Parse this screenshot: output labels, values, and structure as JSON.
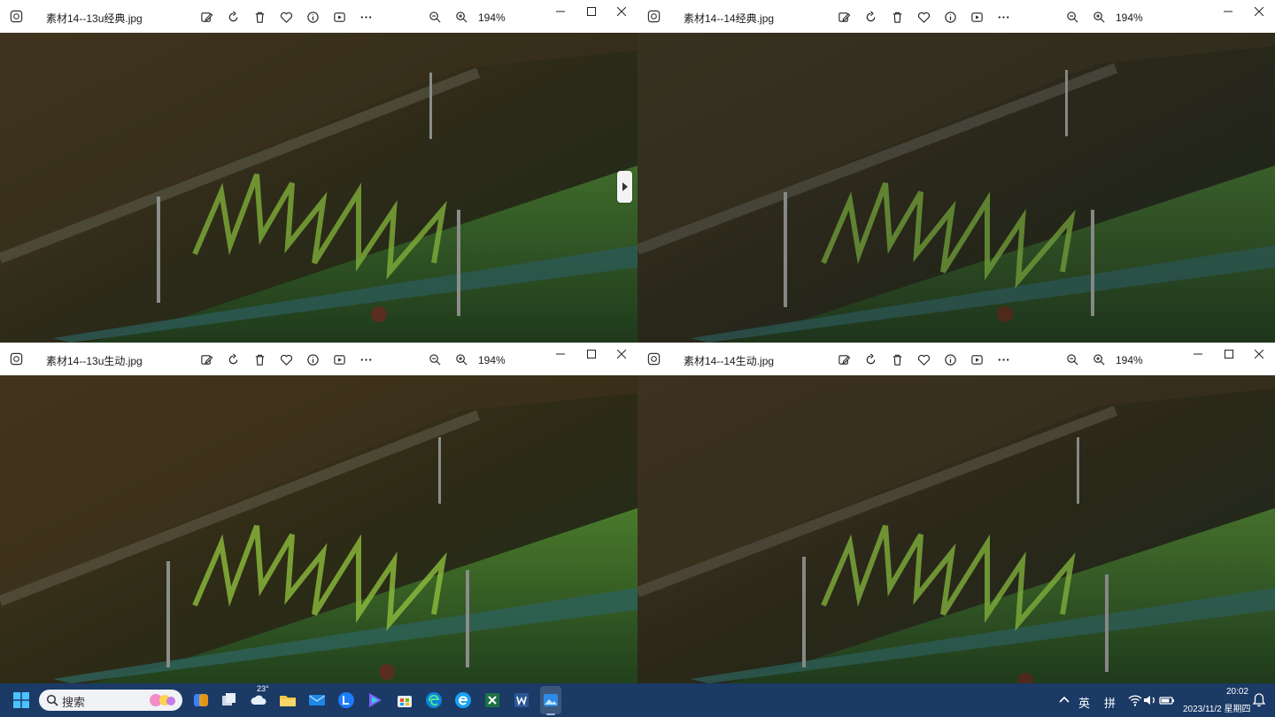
{
  "windows": [
    {
      "title": "素材14--13u经典.jpg",
      "zoom": "194%"
    },
    {
      "title": "素材14--14经典.jpg",
      "zoom": "194%"
    },
    {
      "title": "素材14--13u生动.jpg",
      "zoom": "194%"
    },
    {
      "title": "素材14--14生动.jpg",
      "zoom": "194%"
    }
  ],
  "taskbar": {
    "search_placeholder": "搜索",
    "weather_temp": "23°",
    "ime_lang": "英",
    "ime_mode": "拼",
    "time": "20:02",
    "date": "2023/11/2 星期四"
  },
  "colors": {
    "titlebar": "#ffffff",
    "taskbar": "#1b3a66",
    "active_border": "#2f7ad6"
  }
}
